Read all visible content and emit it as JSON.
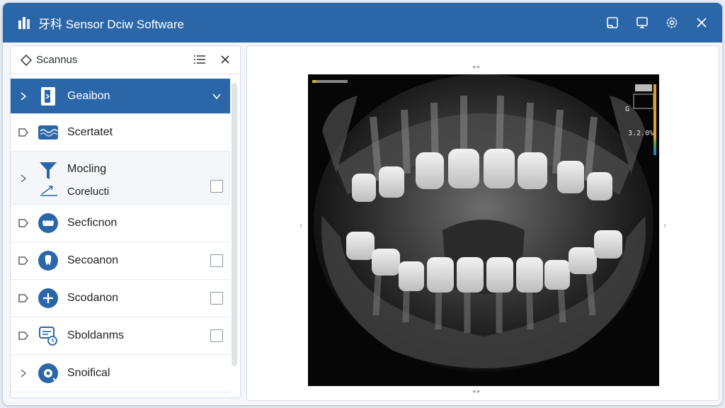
{
  "app": {
    "title": "牙科 Sensor Dciw Software"
  },
  "sidebar": {
    "title": "Scannus",
    "items": [
      {
        "label": "Geaibon"
      },
      {
        "label": "Scertatet"
      },
      {
        "label": "Mocling",
        "sublabel": "Corelucti"
      },
      {
        "label": "Secficnon"
      },
      {
        "label": "Secoanon"
      },
      {
        "label": "Scodanon"
      },
      {
        "label": "Sboldanms"
      },
      {
        "label": "Snoifical"
      }
    ]
  },
  "viewer": {
    "overlay_label": "G",
    "overlay_value": "3.2.0%"
  },
  "colors": {
    "accent": "#2b66a8",
    "window_bg": "#f3f6fa"
  }
}
